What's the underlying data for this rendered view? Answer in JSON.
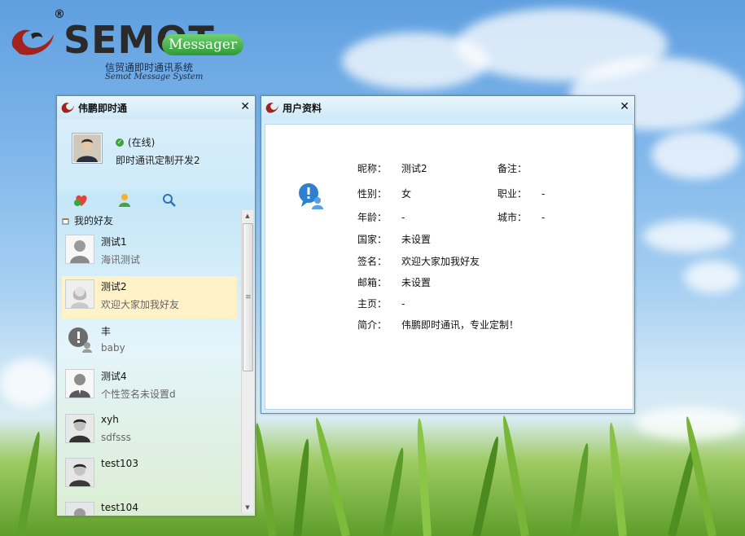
{
  "logo": {
    "reg_mark": "®",
    "brand": "SEMOT",
    "badge": "Messager",
    "subtitle_cn": "信贸通即时通讯系统",
    "subtitle_en": "Semot Message System"
  },
  "contacts_window": {
    "title": "伟鹏即时通",
    "close_glyph": "✕",
    "status_text": "(在线)",
    "signature": "即时通讯定制开发2",
    "group_name": "我的好友",
    "contacts": [
      {
        "name": "测试1",
        "signature": "海讯测试"
      },
      {
        "name": "测试2",
        "signature": "欢迎大家加我好友"
      },
      {
        "name": "丰",
        "signature": "baby"
      },
      {
        "name": "测试4",
        "signature": "个性签名未设置d"
      },
      {
        "name": "xyh",
        "signature": "sdfsss"
      },
      {
        "name": "test103",
        "signature": ""
      },
      {
        "name": "test104",
        "signature": ""
      }
    ],
    "tools": [
      "add-friend-icon",
      "user-icon",
      "search-icon"
    ]
  },
  "profile_window": {
    "title": "用户资料",
    "close_glyph": "✕",
    "fields": {
      "nickname": {
        "label": "昵称：",
        "value": "测试2"
      },
      "remark": {
        "label": "备注：",
        "value": ""
      },
      "gender": {
        "label": "性别：",
        "value": "女"
      },
      "job": {
        "label": "职业：",
        "value": "-"
      },
      "age": {
        "label": "年龄：",
        "value": "-"
      },
      "city": {
        "label": "城市：",
        "value": "-"
      },
      "country": {
        "label": "国家：",
        "value": "未设置"
      },
      "signature": {
        "label": "签名：",
        "value": "欢迎大家加我好友"
      },
      "email": {
        "label": "邮箱：",
        "value": "未设置"
      },
      "homepage": {
        "label": "主页：",
        "value": "-"
      },
      "intro": {
        "label": "简介：",
        "value": "伟鹏即时通讯，专业定制！"
      }
    }
  },
  "colors": {
    "accent": "#5b8fc2",
    "selected_row": "#fff2c9",
    "online": "#3aa63a",
    "badge_green": "#2f9a35"
  }
}
